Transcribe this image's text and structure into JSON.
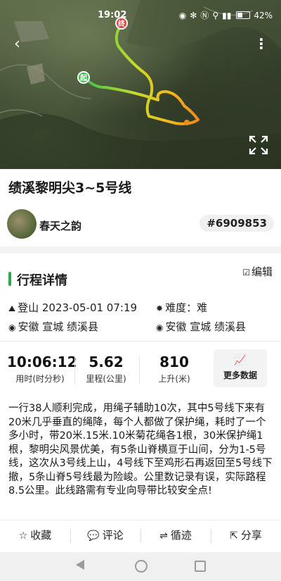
{
  "status_bar": {
    "time": "19:02",
    "battery": "42%",
    "colors": {
      "text": "#ffffff"
    }
  },
  "map": {
    "start_marker": "起",
    "end_marker": "终",
    "colors": {
      "start": "#3cc24a",
      "end": "#e83b3b",
      "track_gradient": [
        "#3cc24a",
        "#c8dc2a",
        "#f5b820",
        "#f08a1c"
      ]
    },
    "icons": [
      "back-arrow-icon",
      "more-vertical-icon",
      "expand-icon"
    ]
  },
  "route": {
    "title": "绩溪黎明尖3~5号线",
    "author": "春天之韵",
    "id": "#6909853"
  },
  "details": {
    "section_title": "行程详情",
    "edit_label": "编辑",
    "activity": "登山 2023-05-01 07:19",
    "difficulty": "难度：难",
    "start_location": "安徽 宣城 绩溪县",
    "end_location": "安徽 宣城 绩溪县"
  },
  "stats": {
    "duration_value": "10:06:12",
    "duration_label": "用时(时分秒)",
    "distance_value": "5.62",
    "distance_label": "里程(公里)",
    "ascent_value": "810",
    "ascent_label": "上升(米)",
    "more_data_label": "更多数据"
  },
  "description": "一行38人顺利完成，用绳子辅助10次，其中5号线下来有20米几乎垂直的绳降，每个人都做了保护绳，耗时了一个多小时，带20米.15米.10米菊花绳各1根，30米保护绳1根，黎明尖风景优美，有5条山脊横亘于山间，分为1-5号线，这次从3号线上山，4号线下至鸡形石再返回至5号线下撤，5条山脊5号线最为险峻。公里数记录有误，实际路程8.5公里。此线路需有专业向导带比较安全点!",
  "actions": {
    "favorite": "收藏",
    "comment": "评论",
    "follow_track": "循迹",
    "share": "分享"
  },
  "accent_color": "#2aa84a"
}
